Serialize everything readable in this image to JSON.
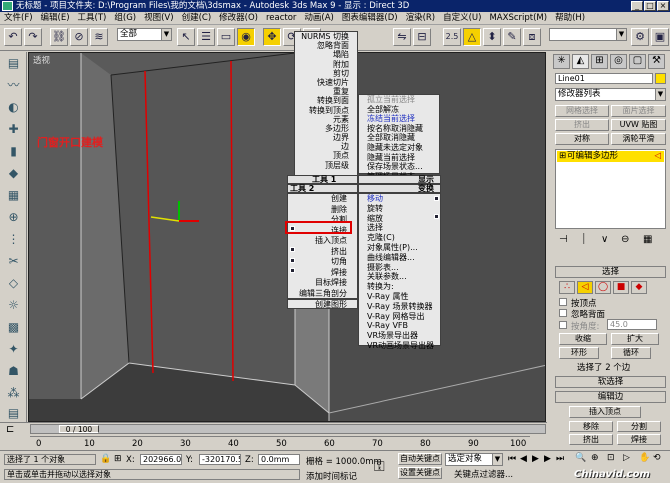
{
  "title": {
    "text": "无标题    - 项目文件夹: D:\\Program Files\\我的文档\\3dsmax    - Autodesk 3ds Max 9    - 显示 : Direct 3D"
  },
  "menubar": [
    "文件(F)",
    "编辑(E)",
    "工具(T)",
    "组(G)",
    "视图(V)",
    "创建(C)",
    "修改器(O)",
    "reactor",
    "动画(A)",
    "图表编辑器(D)",
    "渲染(R)",
    "自定义(U)",
    "MAXScript(M)",
    "帮助(H)"
  ],
  "toolbar": {
    "selection_filter": "全部",
    "coord_system": "视图",
    "spinner_value": "2.5"
  },
  "viewport": {
    "label": "透视",
    "annotation": "门窗开口建模"
  },
  "quad_menu": {
    "top": [
      "NURMS 切换",
      "忽略背面",
      "塌陷",
      "附加",
      "剪切",
      "快速切片",
      "重复",
      "转换到面",
      "转换到顶点",
      "元素",
      "多边形",
      "边界",
      "边",
      "顶点",
      "顶层级"
    ],
    "right_top": [
      "孤立当前选择",
      "全部解冻",
      "冻结当前选择",
      "按名称取消隐藏",
      "全部取消隐藏",
      "隐藏未选定对象",
      "隐藏当前选择",
      "保存场景状态...",
      "管理场景状态..."
    ],
    "header_tools1": "工具 1",
    "header_display": "显示",
    "header_tools2": "工具 2",
    "header_transform": "变换",
    "left_bottom": [
      "创建",
      "删除",
      "分割",
      "连接",
      "插入顶点",
      "挤出",
      "切角",
      "焊接",
      "目标焊接",
      "编辑三角剖分",
      "创建图形"
    ],
    "right_bottom": [
      "移动",
      "旋转",
      "缩放",
      "选择",
      "克隆(C)",
      "对象属性(P)...",
      "曲线编辑器...",
      "摄影表...",
      "关联参数...",
      "转换为:",
      "V-Ray 属性",
      "V-Ray 场景转换器",
      "V-Ray 网格导出",
      "V-Ray VFB",
      "VR场景导出器",
      "VR动画场景导出器"
    ]
  },
  "right_panel": {
    "object_name": "Line01",
    "modifier_list": "修改器列表",
    "buttons": [
      "网格选择",
      "面片选择",
      "挤出",
      "UVW 贴图",
      "对称",
      "涡轮平滑"
    ],
    "stack_item": "可编辑多边形",
    "selection_rollout": "选择",
    "by_vertex": "按顶点",
    "ignore_backfacing": "忽略背面",
    "by_angle": "按角度:",
    "angle_value": "45.0",
    "shrink": "收缩",
    "grow": "扩大",
    "ring": "环形",
    "loop": "循环",
    "selected_info": "选择了 2 个边",
    "soft_selection": "软选择",
    "edit_edges": "编辑边",
    "insert_vertex": "插入顶点",
    "remove": "移除",
    "split": "分割",
    "extrude": "挤出",
    "weld": "焊接"
  },
  "timeline": {
    "frame": "0 / 100",
    "ticks": [
      "0",
      "10",
      "20",
      "30",
      "40",
      "50",
      "60",
      "70",
      "80",
      "90",
      "100"
    ]
  },
  "statusbar": {
    "selected": "选择了 1 个对象",
    "prompt": "单击或单击并拖动以选择对象",
    "x_value": "202966.0",
    "y_value": "-320170.5",
    "z_value": "0.0mm",
    "grid": "栅格 = 1000.0mm",
    "auto_key": "自动关键点",
    "selected_obj": "选定对象",
    "set_key": "设置关键点",
    "key_filters": "关键点过滤器...",
    "add_time_tag": "添加时间标记",
    "watermark": "Chinavid.com"
  }
}
